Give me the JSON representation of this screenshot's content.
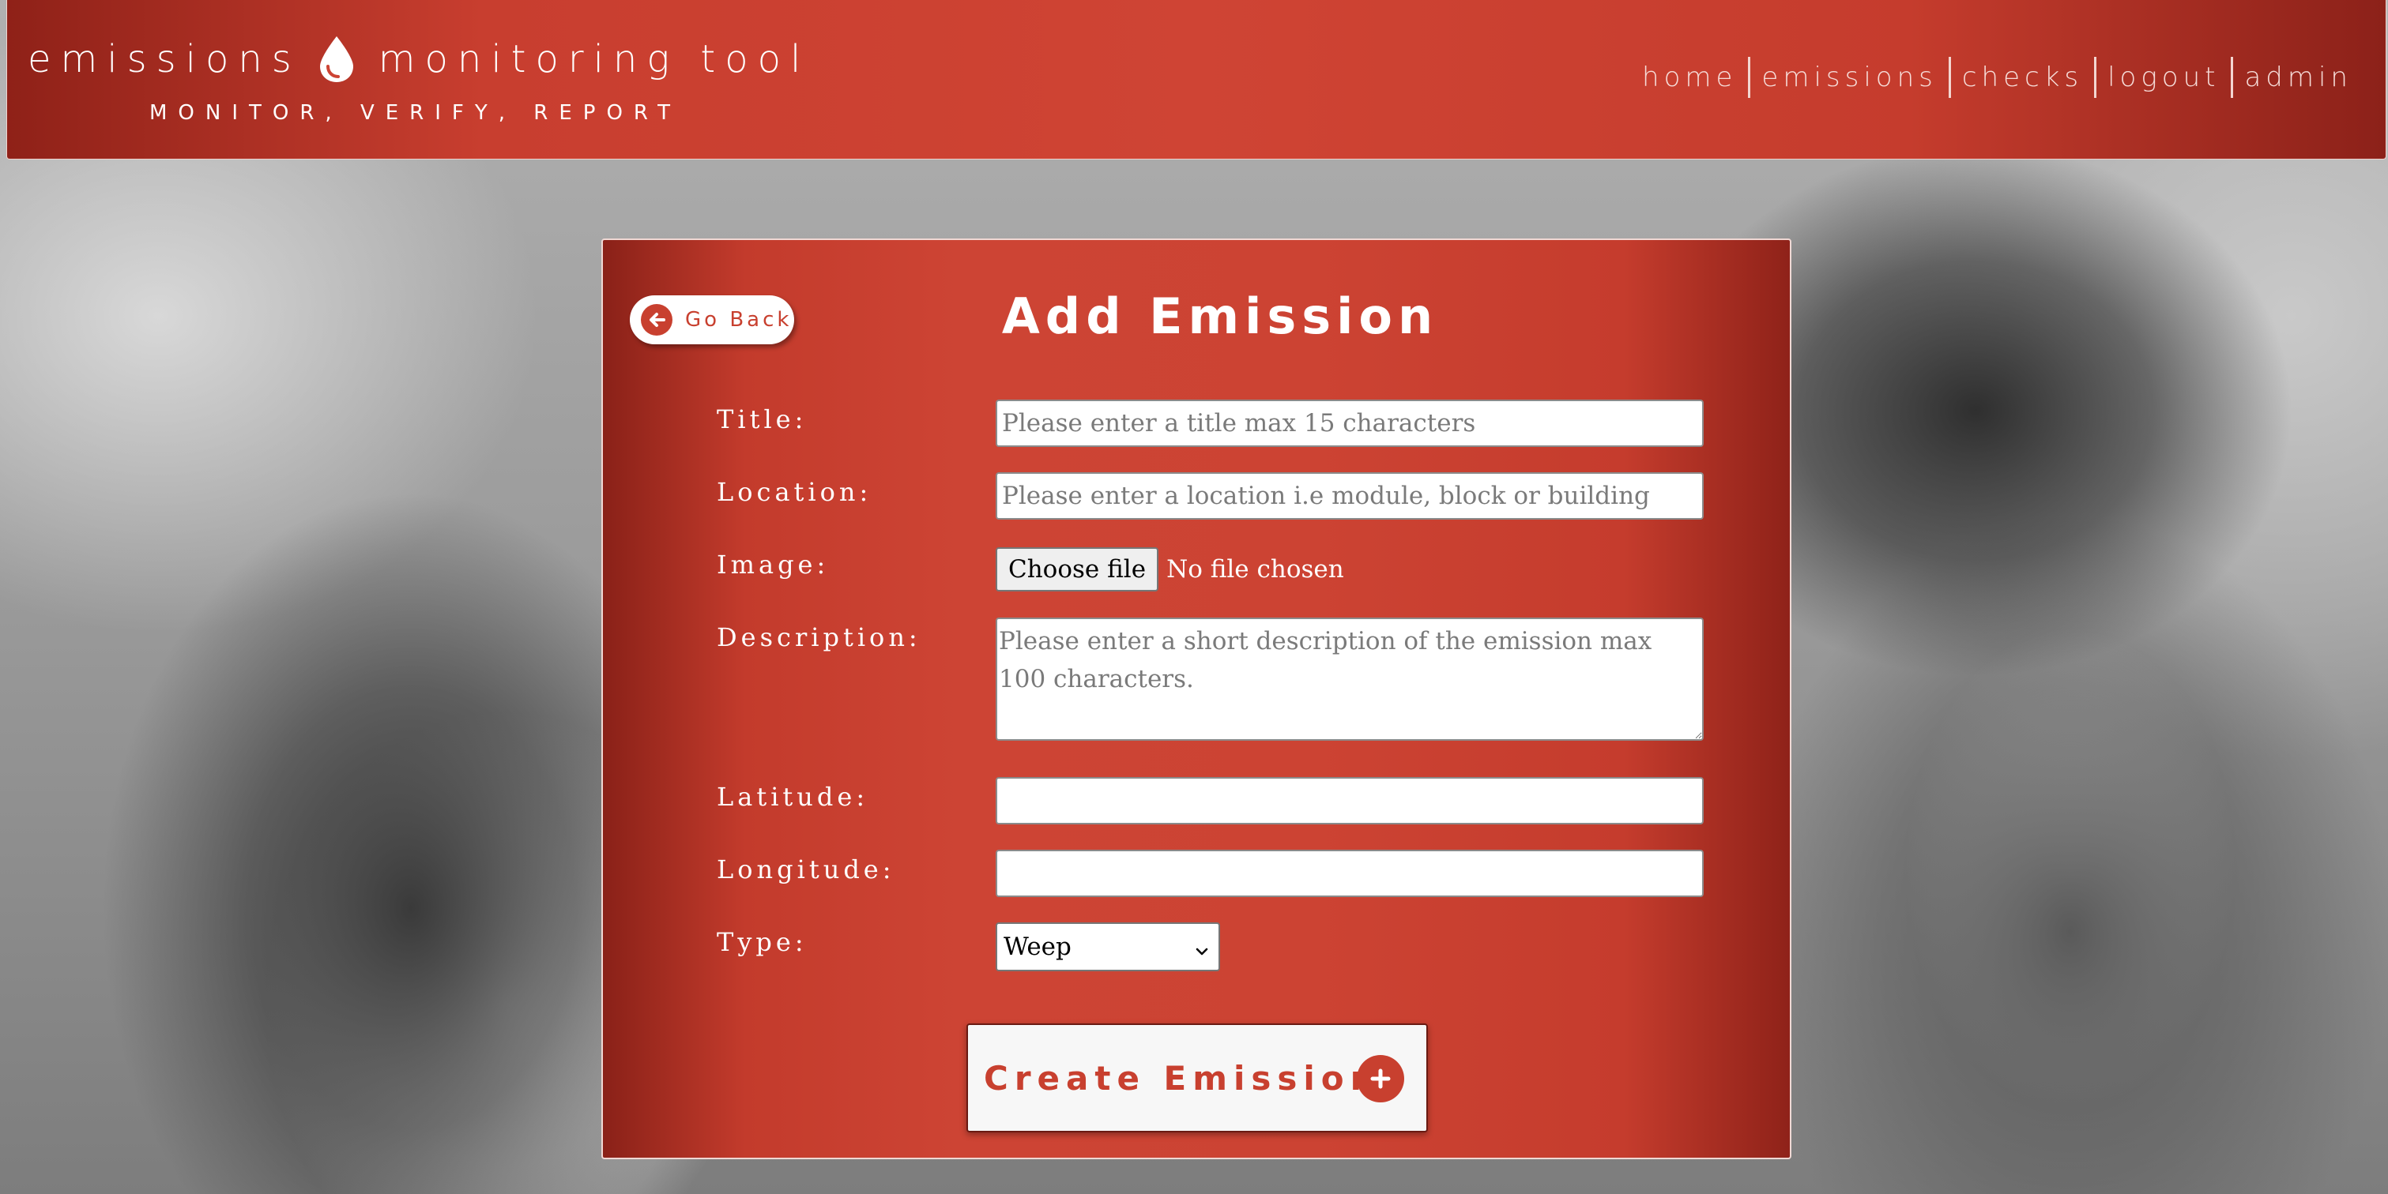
{
  "header": {
    "brand_left": "emissions",
    "brand_right": "monitoring tool",
    "tagline": "MONITOR, VERIFY, REPORT",
    "nav": {
      "home": "home",
      "emissions": "emissions",
      "checks": "checks",
      "logout": "logout",
      "admin": "admin"
    }
  },
  "form": {
    "go_back": "Go Back",
    "title": "Add Emission",
    "labels": {
      "title": "Title:",
      "location": "Location:",
      "image": "Image:",
      "description": "Description:",
      "latitude": "Latitude:",
      "longitude": "Longitude:",
      "type": "Type:"
    },
    "placeholders": {
      "title": "Please enter a title max 15 characters",
      "location": "Please enter a location i.e module, block or building",
      "description": "Please enter a short description of the emission max 100 characters."
    },
    "values": {
      "latitude": "",
      "longitude": ""
    },
    "file": {
      "button": "Choose file",
      "status": "No file chosen"
    },
    "type_selected": "Weep",
    "submit": "Create Emission"
  },
  "colors": {
    "brand_red": "#cd4434",
    "dark_red": "#8c2119",
    "white": "#ffffff"
  },
  "icons": {
    "brand": "water-drop-icon",
    "go_back": "arrow-left-circle-icon",
    "submit": "plus-circle-icon",
    "select": "chevron-down-icon"
  }
}
